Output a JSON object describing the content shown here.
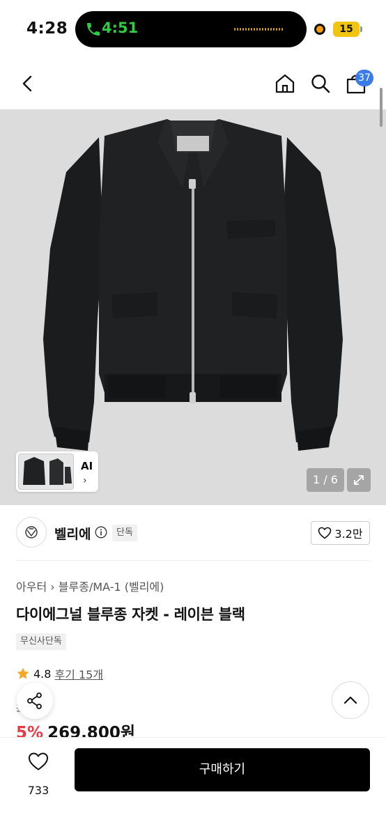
{
  "status_bar": {
    "time": "4:28",
    "call_time": "4:51",
    "battery": "15"
  },
  "nav": {
    "cart_count": "37"
  },
  "gallery": {
    "ai_label": "AI",
    "pager": "1 / 6"
  },
  "brand": {
    "name": "벨리에",
    "exclusive_tag": "단독",
    "likes": "3.2만"
  },
  "product": {
    "breadcrumb_1": "아우터",
    "breadcrumb_2": "블루종/MA-1 (벨리에)",
    "title": "다이에그널 블루종 자켓 - 레이븐 블랙",
    "tag": "무신사단독",
    "rating": "4.8",
    "reviews": "후기 15개",
    "original_price": "2 0원",
    "discount": "5%",
    "price": "269,800원"
  },
  "bottom_bar": {
    "fav_count": "733",
    "buy_label": "구매하기"
  },
  "colors": {
    "accent_blue": "#3b7be8",
    "discount_red": "#e63946",
    "call_green": "#2ecc40",
    "star_orange": "#f5a623"
  }
}
